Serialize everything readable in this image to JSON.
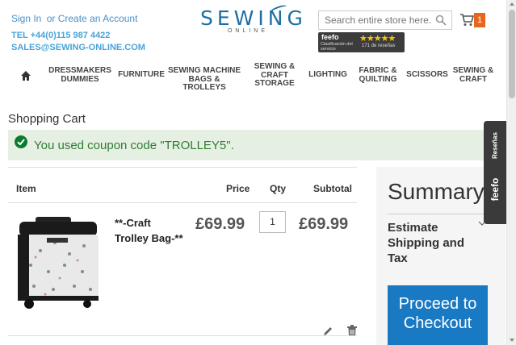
{
  "header": {
    "sign_in": "Sign In",
    "or_create": "or Create an Account",
    "phone": "TEL +44(0)115 987 4422",
    "email": "SALES@SEWING-ONLINE.COM",
    "logo_main": "SEWING",
    "logo_sub": "ONLINE",
    "search_placeholder": "Search entire store here...",
    "cart_count": "1",
    "feefo_logo": "feefo",
    "feefo_sub": "Clasificación del servicio",
    "feefo_stars": "★★★★★",
    "feefo_count": "171 de reseñas"
  },
  "nav": {
    "home_icon": "home-icon",
    "items": [
      {
        "label": "DRESSMAKERS DUMMIES"
      },
      {
        "label": "FURNITURE"
      },
      {
        "label": "SEWING MACHINE BAGS & TROLLEYS"
      },
      {
        "label": "SEWING & CRAFT STORAGE"
      },
      {
        "label": "LIGHTING"
      },
      {
        "label": "FABRIC & QUILTING"
      },
      {
        "label": "SCISSORS"
      },
      {
        "label": "SEWING & CRAFT"
      }
    ]
  },
  "main": {
    "page_title": "Shopping Cart",
    "message": "You used coupon code \"TROLLEY5\".",
    "table": {
      "headers": {
        "item": "Item",
        "price": "Price",
        "qty": "Qty",
        "subtotal": "Subtotal"
      },
      "row": {
        "name": "**-Craft Trolley Bag-**",
        "price": "£69.99",
        "qty": "1",
        "subtotal": "£69.99"
      }
    }
  },
  "summary": {
    "title": "Summary",
    "estimate": "Estimate Shipping and Tax",
    "checkout": "Proceed to Checkout"
  },
  "feefo_tab": {
    "label": "Reseñas",
    "logo": "feefo"
  },
  "colors": {
    "brand_blue": "#1c6fa3",
    "link_blue": "#4a90c8",
    "accent_orange": "#e8651b",
    "success_green": "#2e7d32",
    "success_bg": "#e5f0e2",
    "checkout_blue": "#1979c3"
  }
}
